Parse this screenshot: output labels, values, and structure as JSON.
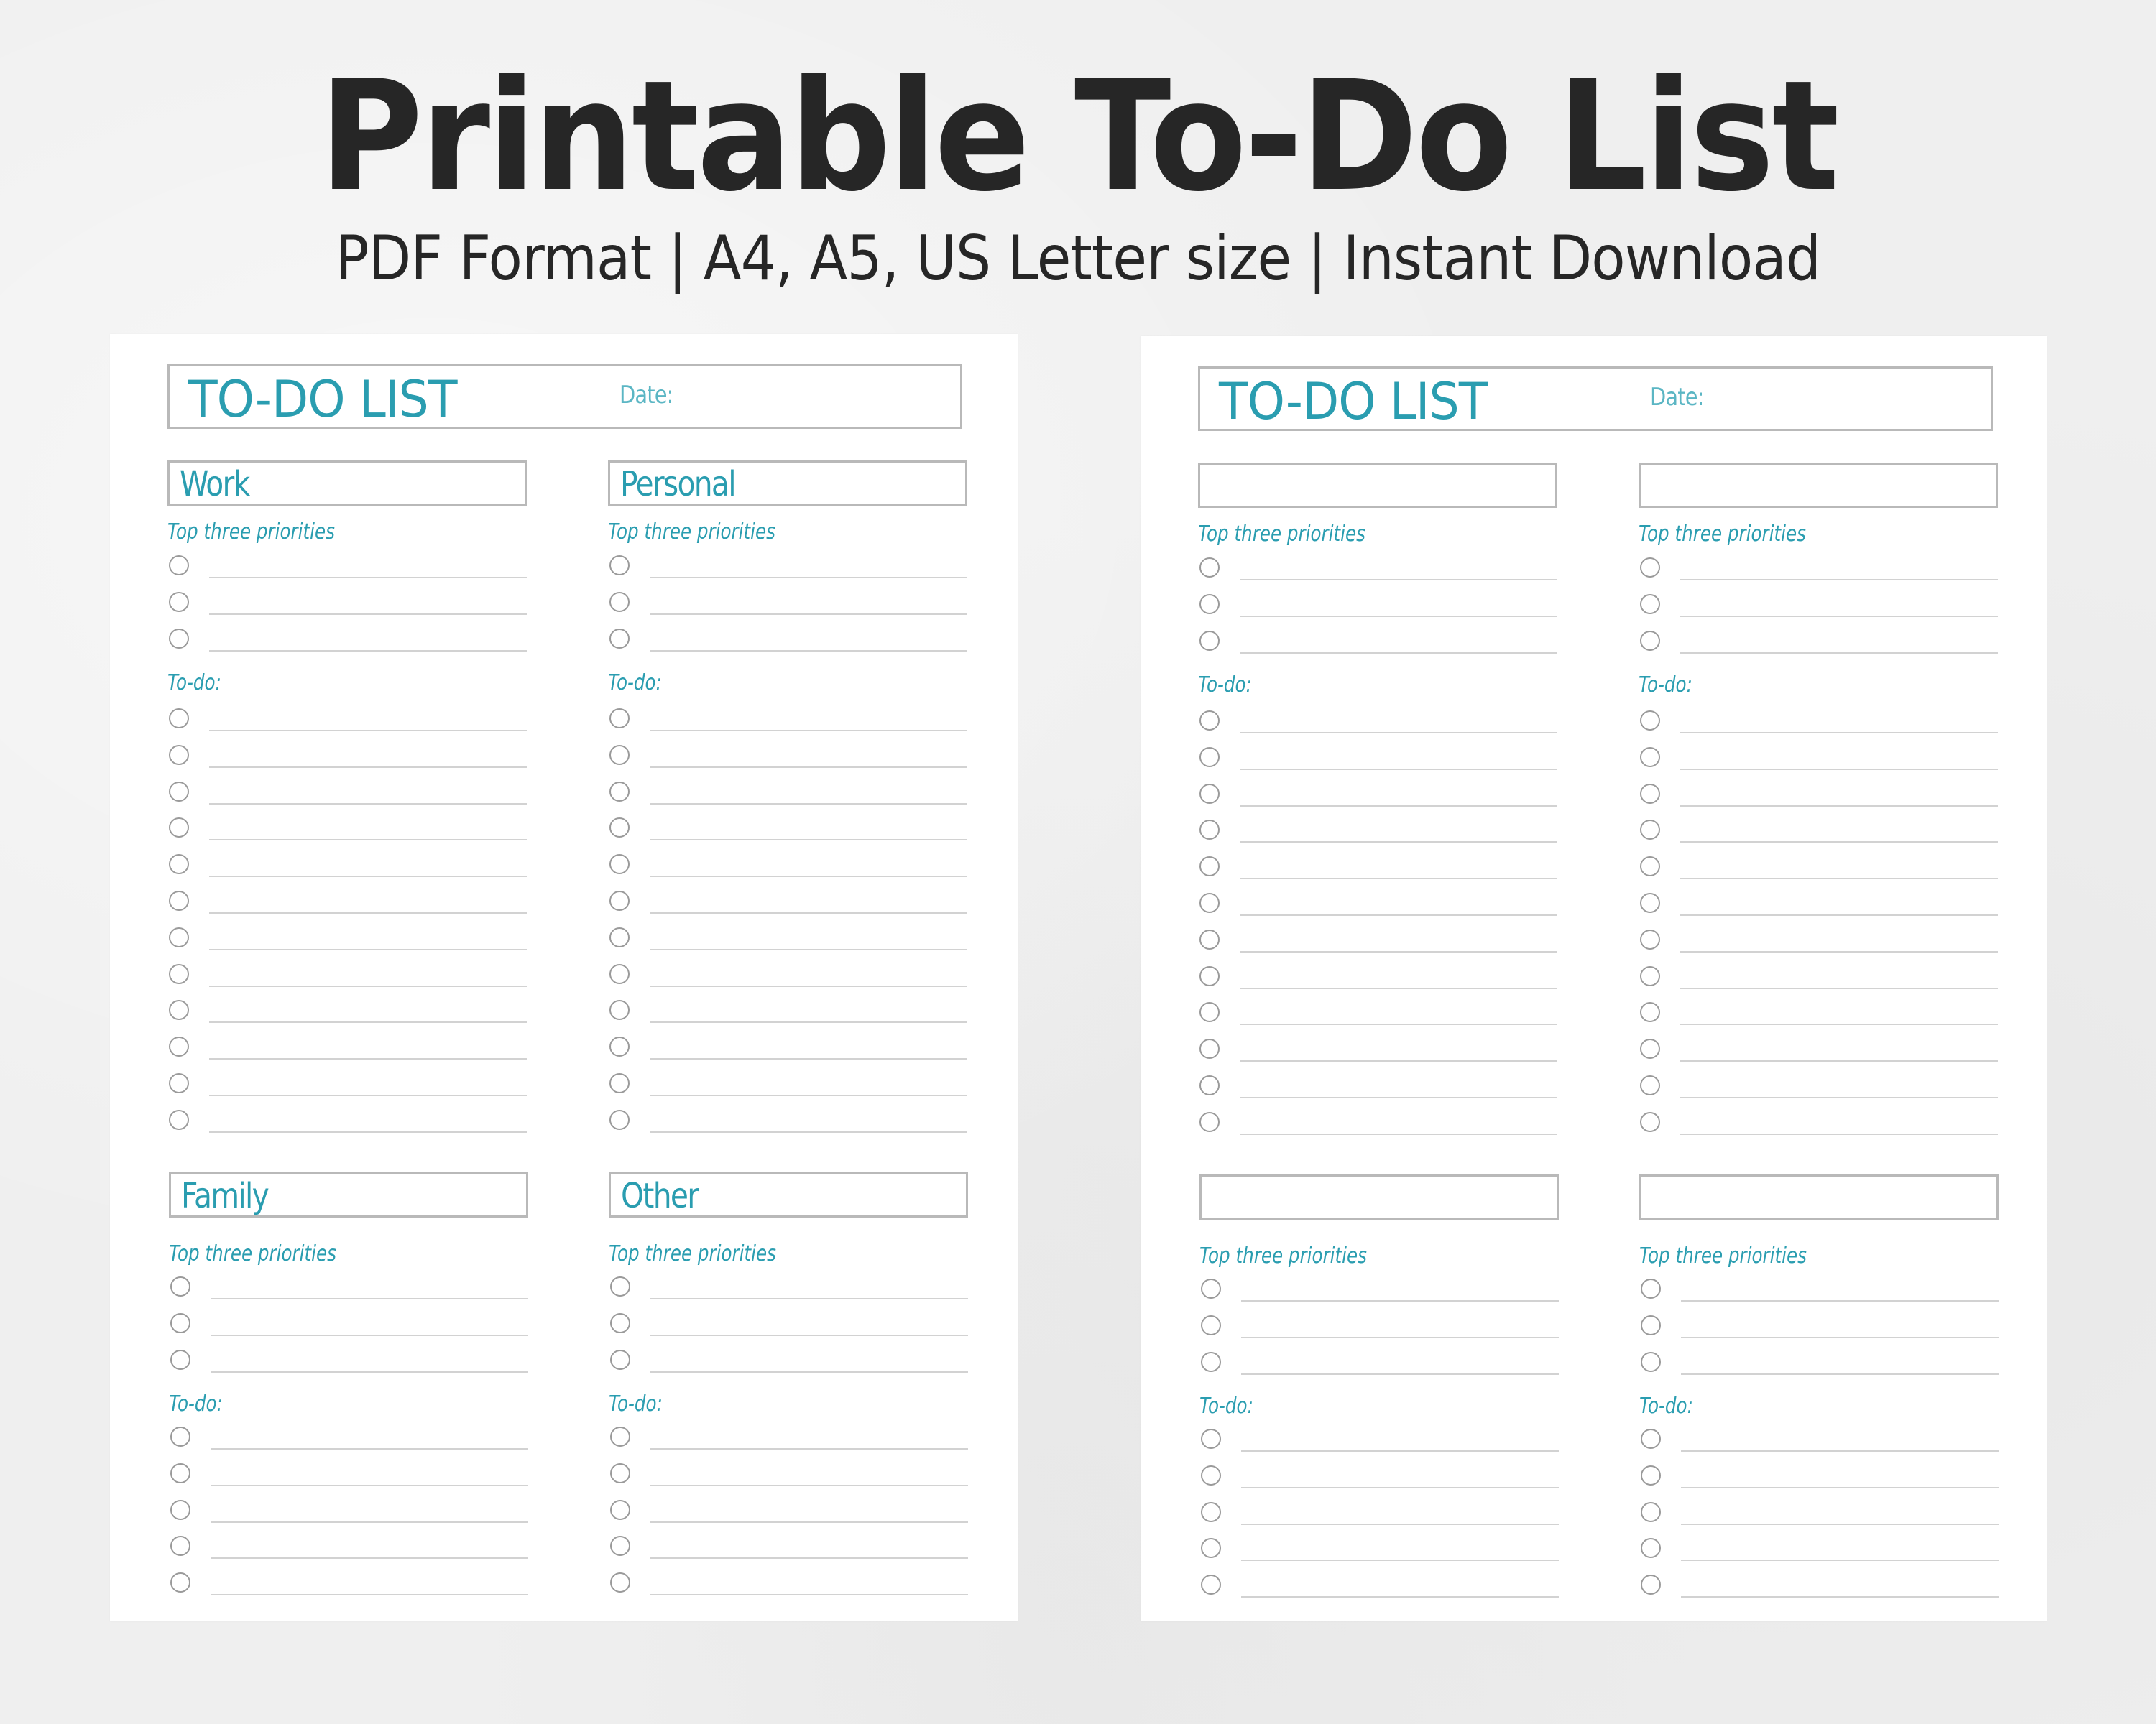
{
  "title": "Printable To-Do List",
  "subtitle": "PDF Format | A4, A5, US Letter size | Instant Download",
  "colors": {
    "accent": "#2a9db0",
    "text_dark": "#262626",
    "box_border": "#b9b9b9",
    "checkbox_border": "#9a9a9a",
    "line": "#d2d2d2",
    "background": "#efefef",
    "page": "#ffffff"
  },
  "icons": {
    "checkbox": "empty-circle-checkbox"
  },
  "pages": [
    {
      "header_title": "TO-DO LIST",
      "date_label": "Date:",
      "sections": [
        {
          "name": "Work",
          "priorities_label": "Top three priorities",
          "priority_count": 3,
          "todo_label": "To-do:",
          "todo_count": 12
        },
        {
          "name": "Personal",
          "priorities_label": "Top three priorities",
          "priority_count": 3,
          "todo_label": "To-do:",
          "todo_count": 12
        },
        {
          "name": "Family",
          "priorities_label": "Top three priorities",
          "priority_count": 3,
          "todo_label": "To-do:",
          "todo_count": 5
        },
        {
          "name": "Other",
          "priorities_label": "Top three priorities",
          "priority_count": 3,
          "todo_label": "To-do:",
          "todo_count": 5
        }
      ]
    },
    {
      "header_title": "TO-DO LIST",
      "date_label": "Date:",
      "sections": [
        {
          "name": "",
          "priorities_label": "Top three priorities",
          "priority_count": 3,
          "todo_label": "To-do:",
          "todo_count": 12
        },
        {
          "name": "",
          "priorities_label": "Top three priorities",
          "priority_count": 3,
          "todo_label": "To-do:",
          "todo_count": 12
        },
        {
          "name": "",
          "priorities_label": "Top three priorities",
          "priority_count": 3,
          "todo_label": "To-do:",
          "todo_count": 5
        },
        {
          "name": "",
          "priorities_label": "Top three priorities",
          "priority_count": 3,
          "todo_label": "To-do:",
          "todo_count": 5
        }
      ]
    }
  ]
}
